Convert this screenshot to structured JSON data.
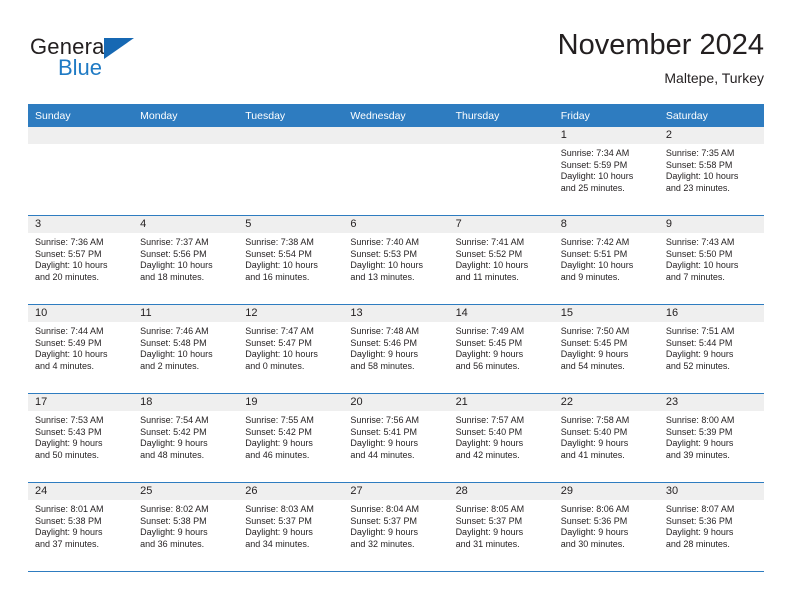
{
  "brand": {
    "name_part1": "General",
    "name_part2": "Blue",
    "flag_icon": "triangle-flag-icon"
  },
  "header": {
    "title": "November 2024",
    "subtitle": "Maltepe, Turkey"
  },
  "calendar": {
    "weekday_headers": [
      "Sunday",
      "Monday",
      "Tuesday",
      "Wednesday",
      "Thursday",
      "Friday",
      "Saturday"
    ],
    "accent_color": "#2e7cc0",
    "daynum_bar_color": "#efefef",
    "weeks": [
      [
        {
          "day": "",
          "lines": []
        },
        {
          "day": "",
          "lines": []
        },
        {
          "day": "",
          "lines": []
        },
        {
          "day": "",
          "lines": []
        },
        {
          "day": "",
          "lines": []
        },
        {
          "day": "1",
          "lines": [
            "Sunrise: 7:34 AM",
            "Sunset: 5:59 PM",
            "Daylight: 10 hours",
            "and 25 minutes."
          ]
        },
        {
          "day": "2",
          "lines": [
            "Sunrise: 7:35 AM",
            "Sunset: 5:58 PM",
            "Daylight: 10 hours",
            "and 23 minutes."
          ]
        }
      ],
      [
        {
          "day": "3",
          "lines": [
            "Sunrise: 7:36 AM",
            "Sunset: 5:57 PM",
            "Daylight: 10 hours",
            "and 20 minutes."
          ]
        },
        {
          "day": "4",
          "lines": [
            "Sunrise: 7:37 AM",
            "Sunset: 5:56 PM",
            "Daylight: 10 hours",
            "and 18 minutes."
          ]
        },
        {
          "day": "5",
          "lines": [
            "Sunrise: 7:38 AM",
            "Sunset: 5:54 PM",
            "Daylight: 10 hours",
            "and 16 minutes."
          ]
        },
        {
          "day": "6",
          "lines": [
            "Sunrise: 7:40 AM",
            "Sunset: 5:53 PM",
            "Daylight: 10 hours",
            "and 13 minutes."
          ]
        },
        {
          "day": "7",
          "lines": [
            "Sunrise: 7:41 AM",
            "Sunset: 5:52 PM",
            "Daylight: 10 hours",
            "and 11 minutes."
          ]
        },
        {
          "day": "8",
          "lines": [
            "Sunrise: 7:42 AM",
            "Sunset: 5:51 PM",
            "Daylight: 10 hours",
            "and 9 minutes."
          ]
        },
        {
          "day": "9",
          "lines": [
            "Sunrise: 7:43 AM",
            "Sunset: 5:50 PM",
            "Daylight: 10 hours",
            "and 7 minutes."
          ]
        }
      ],
      [
        {
          "day": "10",
          "lines": [
            "Sunrise: 7:44 AM",
            "Sunset: 5:49 PM",
            "Daylight: 10 hours",
            "and 4 minutes."
          ]
        },
        {
          "day": "11",
          "lines": [
            "Sunrise: 7:46 AM",
            "Sunset: 5:48 PM",
            "Daylight: 10 hours",
            "and 2 minutes."
          ]
        },
        {
          "day": "12",
          "lines": [
            "Sunrise: 7:47 AM",
            "Sunset: 5:47 PM",
            "Daylight: 10 hours",
            "and 0 minutes."
          ]
        },
        {
          "day": "13",
          "lines": [
            "Sunrise: 7:48 AM",
            "Sunset: 5:46 PM",
            "Daylight: 9 hours",
            "and 58 minutes."
          ]
        },
        {
          "day": "14",
          "lines": [
            "Sunrise: 7:49 AM",
            "Sunset: 5:45 PM",
            "Daylight: 9 hours",
            "and 56 minutes."
          ]
        },
        {
          "day": "15",
          "lines": [
            "Sunrise: 7:50 AM",
            "Sunset: 5:45 PM",
            "Daylight: 9 hours",
            "and 54 minutes."
          ]
        },
        {
          "day": "16",
          "lines": [
            "Sunrise: 7:51 AM",
            "Sunset: 5:44 PM",
            "Daylight: 9 hours",
            "and 52 minutes."
          ]
        }
      ],
      [
        {
          "day": "17",
          "lines": [
            "Sunrise: 7:53 AM",
            "Sunset: 5:43 PM",
            "Daylight: 9 hours",
            "and 50 minutes."
          ]
        },
        {
          "day": "18",
          "lines": [
            "Sunrise: 7:54 AM",
            "Sunset: 5:42 PM",
            "Daylight: 9 hours",
            "and 48 minutes."
          ]
        },
        {
          "day": "19",
          "lines": [
            "Sunrise: 7:55 AM",
            "Sunset: 5:42 PM",
            "Daylight: 9 hours",
            "and 46 minutes."
          ]
        },
        {
          "day": "20",
          "lines": [
            "Sunrise: 7:56 AM",
            "Sunset: 5:41 PM",
            "Daylight: 9 hours",
            "and 44 minutes."
          ]
        },
        {
          "day": "21",
          "lines": [
            "Sunrise: 7:57 AM",
            "Sunset: 5:40 PM",
            "Daylight: 9 hours",
            "and 42 minutes."
          ]
        },
        {
          "day": "22",
          "lines": [
            "Sunrise: 7:58 AM",
            "Sunset: 5:40 PM",
            "Daylight: 9 hours",
            "and 41 minutes."
          ]
        },
        {
          "day": "23",
          "lines": [
            "Sunrise: 8:00 AM",
            "Sunset: 5:39 PM",
            "Daylight: 9 hours",
            "and 39 minutes."
          ]
        }
      ],
      [
        {
          "day": "24",
          "lines": [
            "Sunrise: 8:01 AM",
            "Sunset: 5:38 PM",
            "Daylight: 9 hours",
            "and 37 minutes."
          ]
        },
        {
          "day": "25",
          "lines": [
            "Sunrise: 8:02 AM",
            "Sunset: 5:38 PM",
            "Daylight: 9 hours",
            "and 36 minutes."
          ]
        },
        {
          "day": "26",
          "lines": [
            "Sunrise: 8:03 AM",
            "Sunset: 5:37 PM",
            "Daylight: 9 hours",
            "and 34 minutes."
          ]
        },
        {
          "day": "27",
          "lines": [
            "Sunrise: 8:04 AM",
            "Sunset: 5:37 PM",
            "Daylight: 9 hours",
            "and 32 minutes."
          ]
        },
        {
          "day": "28",
          "lines": [
            "Sunrise: 8:05 AM",
            "Sunset: 5:37 PM",
            "Daylight: 9 hours",
            "and 31 minutes."
          ]
        },
        {
          "day": "29",
          "lines": [
            "Sunrise: 8:06 AM",
            "Sunset: 5:36 PM",
            "Daylight: 9 hours",
            "and 30 minutes."
          ]
        },
        {
          "day": "30",
          "lines": [
            "Sunrise: 8:07 AM",
            "Sunset: 5:36 PM",
            "Daylight: 9 hours",
            "and 28 minutes."
          ]
        }
      ]
    ]
  }
}
